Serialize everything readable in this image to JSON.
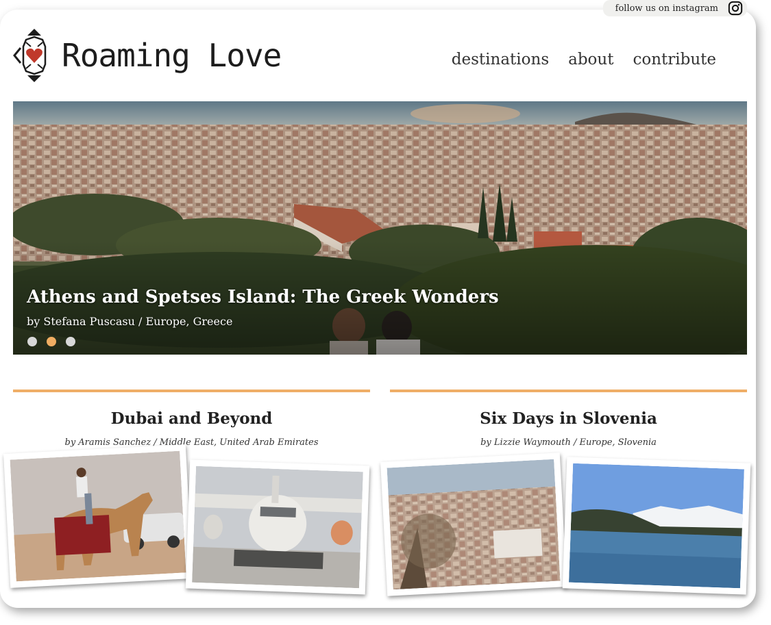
{
  "header": {
    "instagram_label": "follow us on instagram",
    "logo_text": "Roaming Love",
    "nav": [
      {
        "label": "destinations"
      },
      {
        "label": "about"
      },
      {
        "label": "contribute"
      }
    ]
  },
  "hero": {
    "title": "Athens and Spetses Island: The Greek Wonders",
    "byline": "by Stefana Puscasu / Europe, Greece",
    "slides": 3,
    "active_slide": 2
  },
  "posts": [
    {
      "title": "Dubai and Beyond",
      "byline": "by Aramis Sanchez / Middle East, United Arab Emirates"
    },
    {
      "title": "Six Days in Slovenia",
      "byline": "by Lizzie Waymouth / Europe, Slovenia"
    }
  ],
  "colors": {
    "accent": "#efae67",
    "logo_heart": "#c0392b",
    "text": "#222222"
  }
}
